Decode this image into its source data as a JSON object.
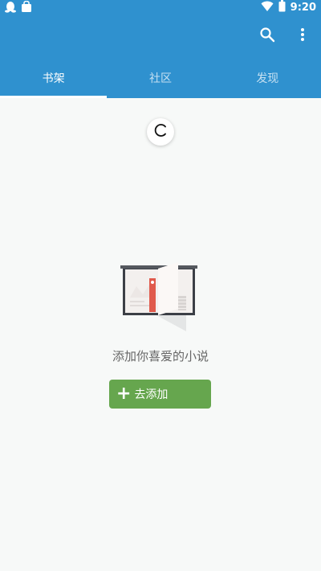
{
  "status_bar": {
    "time": "9:20",
    "left_icons": [
      "qq-penguin-icon",
      "bag-icon"
    ],
    "right_icons": [
      "wifi-icon",
      "battery-icon"
    ]
  },
  "toolbar": {
    "actions": [
      "search-icon",
      "more-vert-icon"
    ]
  },
  "tabs": [
    {
      "label": "书架",
      "active": true
    },
    {
      "label": "社区",
      "active": false
    },
    {
      "label": "发现",
      "active": false
    }
  ],
  "refresh_indicator": {
    "icon": "refresh-spinner-icon"
  },
  "empty_state": {
    "illustration": "open-book-icon",
    "message": "添加你喜爱的小说",
    "button_label": "去添加",
    "button_icon": "plus-icon"
  },
  "colors": {
    "primary": "#2f91cf",
    "accent_button": "#66a64e",
    "background": "#f7f9f8"
  }
}
